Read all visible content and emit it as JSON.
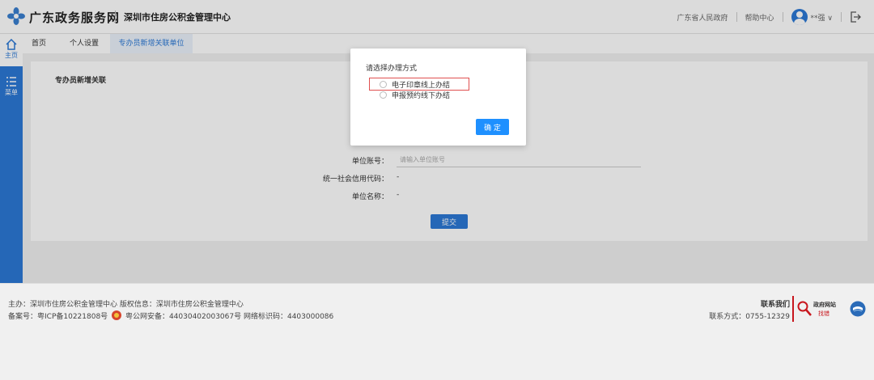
{
  "header": {
    "site_title": "广东政务服务网",
    "org_name": "深圳市住房公积金管理中心",
    "links": [
      "广东省人民政府",
      "帮助中心"
    ],
    "user_name": "**强 ∨"
  },
  "sidebar": {
    "items": [
      {
        "label": "主页",
        "icon": "home-icon"
      },
      {
        "label": "菜单",
        "icon": "menu-icon"
      }
    ]
  },
  "tabs": [
    "首页",
    "个人设置",
    "专办员新增关联单位"
  ],
  "panel": {
    "title": "专办员新增关联",
    "fields": [
      {
        "label": "单位账号：",
        "placeholder": "请输入单位账号"
      },
      {
        "label": "统一社会信用代码：",
        "value": "-"
      },
      {
        "label": "单位名称：",
        "value": "-"
      }
    ],
    "submit_label": "提交"
  },
  "modal": {
    "title": "请选择办理方式",
    "options": [
      "电子印章线上办结",
      "申报预约线下办结"
    ],
    "confirm_label": "确 定"
  },
  "footer": {
    "line1": "主办：深圳市住房公积金管理中心  版权信息：深圳市住房公积金管理中心",
    "icp": "备案号：粤ICP备10221808号",
    "police": "粤公网安备：44030402003067号",
    "site_code": "网络标识码：4403000086",
    "contact_title": "联系我们",
    "contact_phone": "联系方式：0755-12329",
    "gov_site_label": "政府网站",
    "gov_site_sub": "找错"
  },
  "colors": {
    "primary": "#2c79d6",
    "confirm": "#1e90ff",
    "highlight": "#e05050"
  }
}
